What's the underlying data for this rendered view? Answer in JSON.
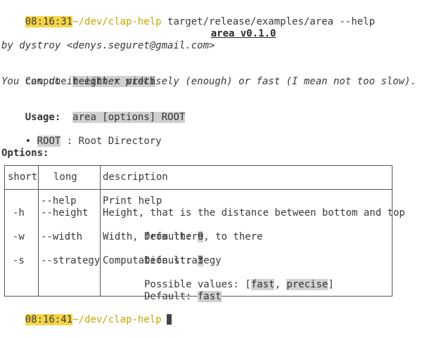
{
  "prompt1": {
    "time": "08:16:31",
    "path": "~/dev/clap-help",
    "command": " target/release/examples/area --help"
  },
  "title": "area v0.1.0",
  "author": "by dystroy <denys.seguret@gmail.com>",
  "description": {
    "line1_prefix": "Compute ",
    "line1_highlight": "height x width",
    "line2": "You can do it either precisely (enough) or fast (I mean not too slow)."
  },
  "usage": {
    "label": "Usage:",
    "value": "area [options] ROOT"
  },
  "args": [
    {
      "bullet": "•",
      "name": "ROOT",
      "sep": " : ",
      "desc": "Root Directory"
    }
  ],
  "options_label": "Options:",
  "table": {
    "headers": {
      "short": "short",
      "long": "long",
      "description": "description"
    },
    "rows": [
      {
        "short": "",
        "long": "--help",
        "desc": "Print help"
      },
      {
        "short": "-h",
        "long": "--height",
        "desc": "Height, that is the distance between bottom and top"
      },
      {
        "short": "",
        "long": "",
        "desc_prefix": " Default: ",
        "desc_hl": "9"
      },
      {
        "short": "-w",
        "long": "--width",
        "desc": "Width, from there, to there"
      },
      {
        "short": "",
        "long": "",
        "desc_prefix": " Default: ",
        "desc_hl": "3"
      },
      {
        "short": "-s",
        "long": "--strategy",
        "desc": "Computation strategy"
      },
      {
        "short": "",
        "long": "",
        "pv_prefix": " Possible values: [",
        "pv_a": "fast",
        "pv_sep": ", ",
        "pv_b": "precise",
        "pv_suffix": "]"
      },
      {
        "short": "",
        "long": "",
        "desc_prefix": " Default: ",
        "desc_hl": "fast"
      }
    ]
  },
  "prompt2": {
    "time": "08:16:41",
    "path": "~/dev/clap-help"
  },
  "colors": {
    "prompt_time_bg": "#f5d547",
    "prompt_path": "#c9a500",
    "highlight_bg": "#d0d0d0"
  }
}
